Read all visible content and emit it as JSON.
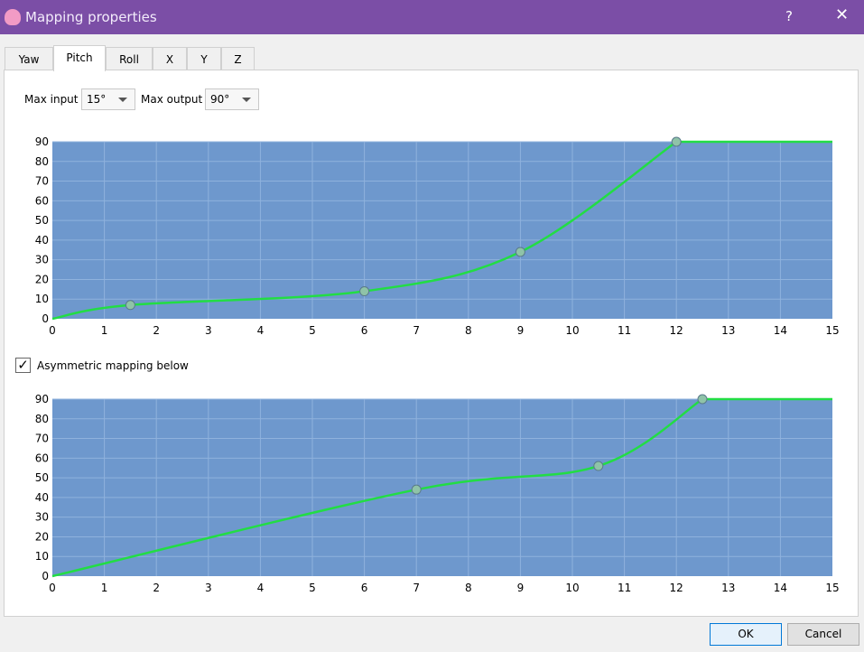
{
  "window": {
    "title": "Mapping properties",
    "help": "?",
    "close": "✕"
  },
  "tabs": [
    {
      "label": "Yaw"
    },
    {
      "label": "Pitch"
    },
    {
      "label": "Roll"
    },
    {
      "label": "X"
    },
    {
      "label": "Y"
    },
    {
      "label": "Z"
    }
  ],
  "active_tab": "Pitch",
  "max_input": {
    "label": "Max input",
    "value": "15°"
  },
  "max_output": {
    "label": "Max output",
    "value": "90°"
  },
  "asymmetric": {
    "label": "Asymmetric mapping below",
    "checked": true,
    "mark": "✓"
  },
  "buttons": {
    "ok": "OK",
    "cancel": "Cancel"
  },
  "colors": {
    "plot_bg": "#6e98cd",
    "curve": "#22dd44",
    "titlebar": "#7b4ea6"
  },
  "chart_data": [
    {
      "type": "line",
      "xlim": [
        0,
        15
      ],
      "ylim": [
        0,
        90
      ],
      "xticks": [
        "0",
        "1",
        "2",
        "3",
        "4",
        "5",
        "6",
        "7",
        "8",
        "9",
        "10",
        "11",
        "12",
        "13",
        "14",
        "15"
      ],
      "yticks": [
        "0",
        "10",
        "20",
        "30",
        "40",
        "50",
        "60",
        "70",
        "80",
        "90"
      ],
      "grid": true,
      "points": [
        [
          0,
          0
        ],
        [
          1.5,
          7
        ],
        [
          6,
          14
        ],
        [
          9,
          34
        ],
        [
          12,
          90
        ],
        [
          15,
          90
        ]
      ],
      "handles": [
        [
          1.5,
          7
        ],
        [
          6,
          14
        ],
        [
          9,
          34
        ],
        [
          12,
          90
        ]
      ]
    },
    {
      "type": "line",
      "xlim": [
        0,
        15
      ],
      "ylim": [
        0,
        90
      ],
      "xticks": [
        "0",
        "1",
        "2",
        "3",
        "4",
        "5",
        "6",
        "7",
        "8",
        "9",
        "10",
        "11",
        "12",
        "13",
        "14",
        "15"
      ],
      "yticks": [
        "0",
        "10",
        "20",
        "30",
        "40",
        "50",
        "60",
        "70",
        "80",
        "90"
      ],
      "grid": true,
      "points": [
        [
          0,
          0
        ],
        [
          7,
          44
        ],
        [
          10.5,
          56
        ],
        [
          12.5,
          90
        ],
        [
          15,
          90
        ]
      ],
      "handles": [
        [
          7,
          44
        ],
        [
          10.5,
          56
        ],
        [
          12.5,
          90
        ]
      ]
    }
  ]
}
